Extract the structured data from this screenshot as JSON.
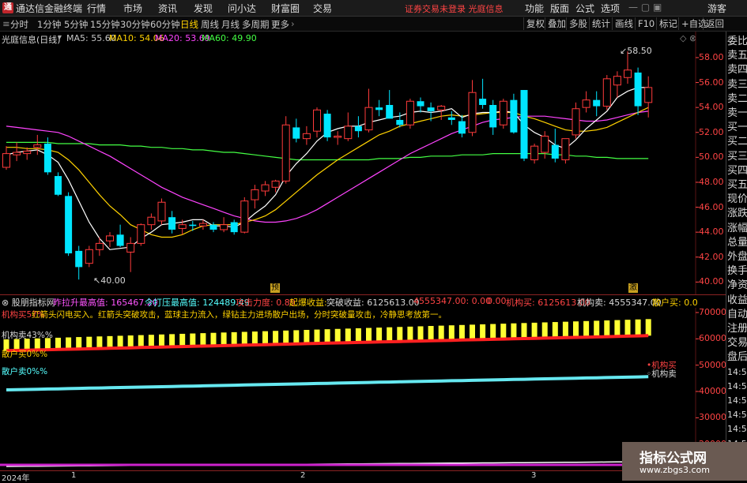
{
  "window": {
    "app_title": "通达信金融终端",
    "menu": [
      "行情",
      "市场",
      "资讯",
      "发现",
      "问小达",
      "财富圈",
      "交易"
    ],
    "notice": "证券交易未登录  光庭信息",
    "right_menu": [
      "功能",
      "版面",
      "公式",
      "选项"
    ],
    "user": "游客"
  },
  "toolbar": {
    "periods": [
      "分时",
      "1分钟",
      "5分钟",
      "15分钟",
      "30分钟",
      "60分钟",
      "日线",
      "周线",
      "月线",
      "多周期",
      "更多"
    ],
    "active_period": "日线",
    "right_buttons": [
      "复权",
      "叠加",
      "多股",
      "统计",
      "画线",
      "F10",
      "标记",
      "+自选",
      "返回"
    ]
  },
  "chart_header": {
    "stock_name": "光庭信息(日线)",
    "ma": [
      {
        "label": "MA5: 55.60",
        "color": "#ffffff"
      },
      {
        "label": "MA10: 54.06",
        "color": "#ffd200"
      },
      {
        "label": "MA20: 53.69",
        "color": "#ff44ff"
      },
      {
        "label": "MA60: 49.90",
        "color": "#44ff44"
      }
    ]
  },
  "sidebar": [
    "委比",
    "卖五",
    "卖四",
    "卖三",
    "卖二",
    "卖一",
    "买一",
    "买二",
    "买三",
    "买四",
    "买五",
    "现价",
    "涨跌",
    "涨幅",
    "总量",
    "外盘",
    "换手",
    "净资",
    "收益",
    "自动",
    "注册",
    "交易",
    "盘后",
    "14:56",
    "14:56",
    "14:56",
    "14:56",
    "14:56",
    "14:56"
  ],
  "indicator_header": {
    "name": "股朋指标网",
    "items": [
      {
        "text": "昨拉升最高值: 165467.20",
        "color": "#ff55ff"
      },
      {
        "text": "今打压最高值: 124489.49",
        "color": "#55ffff"
      },
      {
        "text": "攻击力度: 0.89",
        "color": "#ff4444"
      },
      {
        "text": "起爆收益: ",
        "color": "#ffd200"
      },
      {
        "text": "突破收益: 6125613.00",
        "color": "#d8d8d8"
      },
      {
        "text": "4555347.00: 0.00",
        "color": "#ff4444"
      },
      {
        "text": "0.00",
        "color": "#ff4444"
      },
      {
        "text": "机构买: 6125613.00",
        "color": "#ff4444"
      },
      {
        "text": "机构卖: 4555347.00",
        "color": "#d8d8d8"
      },
      {
        "text": "散户买: 0.0",
        "color": "#ffd200"
      }
    ],
    "desc": "红箭头闪电买入。红箭头突破攻击，蓝球主力流入，绿钻主力进场散户出场，分时突破量攻击，冷静思考放第一。",
    "desc_prefix": "机构买57%"
  },
  "indicator_labels": {
    "inst_sell_pct": "机构卖43%%",
    "retail_buy_pct": "散户买0%%",
    "retail_sell_pct": "散户卖0%%",
    "inst_buy_tag": "机构买",
    "inst_sell_tag": "机构卖"
  },
  "annotations": {
    "high": "58.50",
    "low": "40.00",
    "tag1": "预",
    "tag2": "激"
  },
  "x_axis": [
    "2024年",
    "1",
    "2",
    "3"
  ],
  "watermark": {
    "title": "指标公式网",
    "url": "www.zbgs3.com"
  },
  "colors": {
    "up": "#ff3b3b",
    "down": "#00e5ff",
    "ma5": "#ffffff",
    "ma10": "#ffd200",
    "ma20": "#ff44ff",
    "ma60": "#44ff44",
    "grid": "#5a1515"
  },
  "chart_data": {
    "type": "candlestick",
    "price_ylim": [
      39.2,
      59.2
    ],
    "price_ticks": [
      40,
      42,
      44,
      46,
      48,
      50,
      52,
      54,
      56,
      58
    ],
    "indicator_ylim": [
      10000,
      73000
    ],
    "indicator_ticks": [
      20000,
      30000,
      40000,
      50000,
      60000,
      70000
    ],
    "candles": [
      {
        "o": 49.2,
        "h": 50.9,
        "l": 49.0,
        "c": 50.3
      },
      {
        "o": 50.2,
        "h": 51.2,
        "l": 49.7,
        "c": 50.4
      },
      {
        "o": 50.3,
        "h": 50.8,
        "l": 49.8,
        "c": 50.5
      },
      {
        "o": 50.8,
        "h": 51.8,
        "l": 50.2,
        "c": 51.0
      },
      {
        "o": 51.1,
        "h": 51.6,
        "l": 48.6,
        "c": 48.8
      },
      {
        "o": 48.5,
        "h": 48.8,
        "l": 46.9,
        "c": 47.0
      },
      {
        "o": 46.9,
        "h": 47.2,
        "l": 42.1,
        "c": 42.3
      },
      {
        "o": 42.5,
        "h": 42.9,
        "l": 40.2,
        "c": 41.2
      },
      {
        "o": 41.5,
        "h": 42.9,
        "l": 41.2,
        "c": 42.6
      },
      {
        "o": 42.6,
        "h": 43.6,
        "l": 42.1,
        "c": 43.1
      },
      {
        "o": 43.3,
        "h": 44.0,
        "l": 42.8,
        "c": 43.7
      },
      {
        "o": 43.8,
        "h": 44.6,
        "l": 42.8,
        "c": 42.9
      },
      {
        "o": 42.4,
        "h": 43.6,
        "l": 40.8,
        "c": 43.1
      },
      {
        "o": 43.1,
        "h": 44.7,
        "l": 42.9,
        "c": 44.6
      },
      {
        "o": 44.6,
        "h": 45.5,
        "l": 44.2,
        "c": 45.2
      },
      {
        "o": 44.9,
        "h": 46.7,
        "l": 44.6,
        "c": 46.4
      },
      {
        "o": 45.2,
        "h": 45.7,
        "l": 43.9,
        "c": 44.2
      },
      {
        "o": 44.3,
        "h": 45.0,
        "l": 43.8,
        "c": 44.6
      },
      {
        "o": 44.6,
        "h": 44.9,
        "l": 44.1,
        "c": 44.5
      },
      {
        "o": 44.5,
        "h": 45.0,
        "l": 44.2,
        "c": 44.7
      },
      {
        "o": 44.6,
        "h": 44.8,
        "l": 44.0,
        "c": 44.2
      },
      {
        "o": 44.2,
        "h": 45.2,
        "l": 44.0,
        "c": 44.6
      },
      {
        "o": 44.8,
        "h": 45.0,
        "l": 43.8,
        "c": 44.0
      },
      {
        "o": 44.0,
        "h": 46.8,
        "l": 43.9,
        "c": 46.5
      },
      {
        "o": 46.6,
        "h": 47.8,
        "l": 45.9,
        "c": 47.4
      },
      {
        "o": 47.3,
        "h": 48.1,
        "l": 46.9,
        "c": 47.8
      },
      {
        "o": 47.6,
        "h": 48.2,
        "l": 47.2,
        "c": 48.1
      },
      {
        "o": 48.1,
        "h": 53.3,
        "l": 47.9,
        "c": 52.6
      },
      {
        "o": 52.4,
        "h": 53.1,
        "l": 51.2,
        "c": 51.5
      },
      {
        "o": 51.5,
        "h": 52.5,
        "l": 51.0,
        "c": 51.9
      },
      {
        "o": 52.1,
        "h": 54.0,
        "l": 51.6,
        "c": 53.8
      },
      {
        "o": 53.5,
        "h": 53.8,
        "l": 51.3,
        "c": 51.6
      },
      {
        "o": 51.6,
        "h": 52.1,
        "l": 51.0,
        "c": 51.7
      },
      {
        "o": 51.5,
        "h": 53.6,
        "l": 51.3,
        "c": 52.5
      },
      {
        "o": 52.5,
        "h": 53.3,
        "l": 51.6,
        "c": 52.1
      },
      {
        "o": 52.2,
        "h": 55.5,
        "l": 52.0,
        "c": 54.0
      },
      {
        "o": 54.0,
        "h": 54.6,
        "l": 53.3,
        "c": 53.8
      },
      {
        "o": 54.2,
        "h": 55.4,
        "l": 53.5,
        "c": 53.1
      },
      {
        "o": 53.0,
        "h": 53.6,
        "l": 52.4,
        "c": 52.6
      },
      {
        "o": 52.6,
        "h": 54.7,
        "l": 52.3,
        "c": 54.5
      },
      {
        "o": 54.5,
        "h": 54.8,
        "l": 53.6,
        "c": 54.1
      },
      {
        "o": 54.0,
        "h": 54.4,
        "l": 52.9,
        "c": 53.7
      },
      {
        "o": 53.8,
        "h": 54.2,
        "l": 53.0,
        "c": 54.1
      },
      {
        "o": 53.2,
        "h": 53.7,
        "l": 52.6,
        "c": 53.0
      },
      {
        "o": 52.9,
        "h": 53.4,
        "l": 51.6,
        "c": 51.9
      },
      {
        "o": 52.0,
        "h": 56.2,
        "l": 51.7,
        "c": 55.2
      },
      {
        "o": 54.7,
        "h": 56.3,
        "l": 53.9,
        "c": 54.2
      },
      {
        "o": 54.2,
        "h": 54.6,
        "l": 51.8,
        "c": 52.4
      },
      {
        "o": 52.6,
        "h": 54.7,
        "l": 52.3,
        "c": 54.5
      },
      {
        "o": 54.6,
        "h": 55.1,
        "l": 51.9,
        "c": 52.0
      },
      {
        "o": 55.4,
        "h": 55.4,
        "l": 49.7,
        "c": 49.9
      },
      {
        "o": 49.8,
        "h": 51.1,
        "l": 49.5,
        "c": 50.9
      },
      {
        "o": 50.4,
        "h": 52.1,
        "l": 49.9,
        "c": 51.7
      },
      {
        "o": 51.0,
        "h": 52.3,
        "l": 49.6,
        "c": 49.9
      },
      {
        "o": 49.8,
        "h": 51.5,
        "l": 49.5,
        "c": 51.5
      },
      {
        "o": 51.8,
        "h": 54.4,
        "l": 51.5,
        "c": 53.9
      },
      {
        "o": 54.0,
        "h": 55.3,
        "l": 53.6,
        "c": 54.6
      },
      {
        "o": 54.6,
        "h": 55.3,
        "l": 53.3,
        "c": 54.1
      },
      {
        "o": 54.1,
        "h": 56.6,
        "l": 53.8,
        "c": 56.3
      },
      {
        "o": 55.8,
        "h": 56.9,
        "l": 54.8,
        "c": 56.5
      },
      {
        "o": 56.4,
        "h": 58.5,
        "l": 55.9,
        "c": 57.0
      },
      {
        "o": 56.8,
        "h": 57.2,
        "l": 53.4,
        "c": 54.1
      },
      {
        "o": 54.4,
        "h": 56.5,
        "l": 53.2,
        "c": 55.6
      }
    ],
    "ma5": [
      50.2,
      50.4,
      50.5,
      50.6,
      50.2,
      49.6,
      48.2,
      46.5,
      44.8,
      43.5,
      42.6,
      42.7,
      42.8,
      43.5,
      44.0,
      44.6,
      44.7,
      44.8,
      45.0,
      45.0,
      44.5,
      44.5,
      44.4,
      44.8,
      45.5,
      46.1,
      47.0,
      48.5,
      49.5,
      50.3,
      51.3,
      52.0,
      52.3,
      52.5,
      52.5,
      52.8,
      53.0,
      53.2,
      53.3,
      53.6,
      53.7,
      53.6,
      53.7,
      53.9,
      53.2,
      53.5,
      53.6,
      53.6,
      53.7,
      53.6,
      52.6,
      52.0,
      51.6,
      51.0,
      50.7,
      51.4,
      52.3,
      53.0,
      53.7,
      54.8,
      55.3,
      55.6,
      55.6
    ],
    "ma10": [
      50.8,
      50.8,
      50.7,
      50.7,
      50.6,
      50.4,
      49.8,
      49.0,
      48.0,
      47.0,
      46.1,
      45.4,
      44.6,
      44.2,
      43.8,
      43.6,
      43.6,
      43.8,
      44.2,
      44.5,
      44.6,
      44.6,
      44.6,
      44.8,
      45.0,
      45.3,
      45.8,
      46.5,
      47.2,
      47.9,
      48.6,
      49.2,
      49.8,
      50.3,
      50.8,
      51.3,
      51.8,
      52.1,
      52.5,
      52.7,
      52.9,
      53.1,
      53.3,
      53.4,
      53.3,
      53.4,
      53.5,
      53.6,
      53.6,
      53.6,
      53.3,
      53.1,
      52.8,
      52.5,
      52.2,
      52.1,
      52.1,
      52.2,
      52.4,
      52.8,
      53.2,
      53.6,
      54.0
    ],
    "ma20": [
      52.5,
      52.4,
      52.3,
      52.2,
      52.1,
      52.0,
      51.7,
      51.3,
      50.9,
      50.5,
      50.1,
      49.6,
      49.1,
      48.6,
      48.1,
      47.6,
      47.2,
      46.8,
      46.5,
      46.2,
      45.9,
      45.6,
      45.3,
      45.1,
      44.9,
      44.8,
      44.8,
      44.9,
      45.1,
      45.4,
      45.8,
      46.3,
      46.8,
      47.3,
      47.8,
      48.3,
      48.8,
      49.3,
      49.8,
      50.3,
      50.7,
      51.1,
      51.5,
      51.9,
      52.2,
      52.5,
      52.8,
      53.0,
      53.1,
      53.2,
      53.3,
      53.3,
      53.3,
      53.2,
      53.1,
      53.0,
      52.9,
      52.9,
      53.0,
      53.2,
      53.4,
      53.6,
      53.7
    ],
    "ma60": [
      51.2,
      51.2,
      51.2,
      51.2,
      51.2,
      51.1,
      51.1,
      51.1,
      51.1,
      51.0,
      51.0,
      51.0,
      50.9,
      50.9,
      50.8,
      50.8,
      50.7,
      50.7,
      50.6,
      50.6,
      50.5,
      50.4,
      50.4,
      50.3,
      50.2,
      50.1,
      50.0,
      49.9,
      49.8,
      49.8,
      49.8,
      49.8,
      49.8,
      49.8,
      49.8,
      49.8,
      49.9,
      49.9,
      49.9,
      50.0,
      50.0,
      50.1,
      50.1,
      50.1,
      50.2,
      50.2,
      50.2,
      50.3,
      50.3,
      50.3,
      50.3,
      50.3,
      50.3,
      50.2,
      50.2,
      50.1,
      50.1,
      50.0,
      50.0,
      49.9,
      49.9,
      49.9,
      49.9
    ],
    "inst_buy": {
      "start": 55500,
      "end": 61200
    },
    "inst_sell_bars": {
      "start": 59800,
      "end": 67500
    },
    "retail_sell": {
      "start": 40600,
      "end": 45600
    },
    "white_line": {
      "start": 11500,
      "end": 13300
    }
  }
}
